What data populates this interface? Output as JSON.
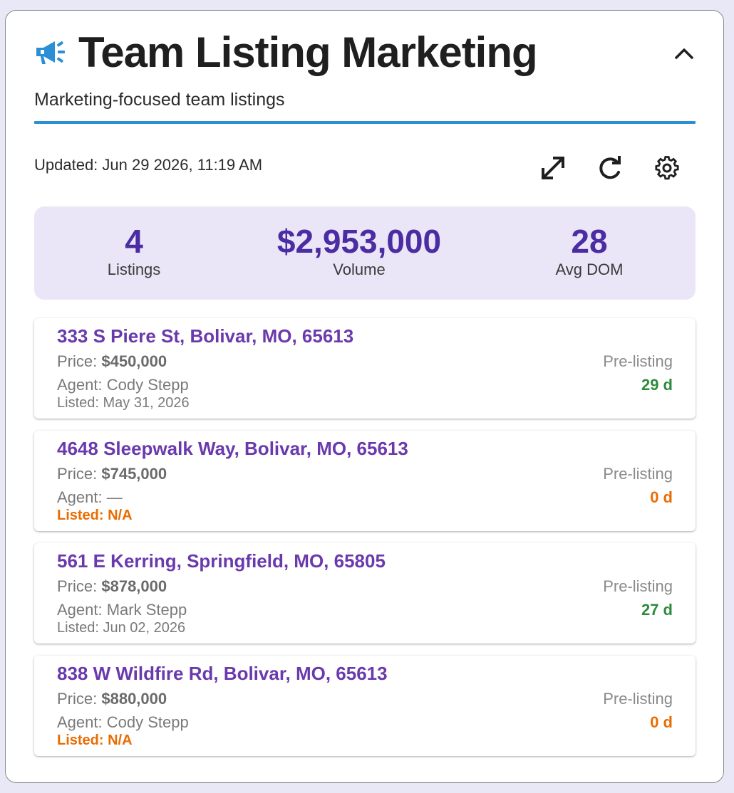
{
  "header": {
    "title": "Team Listing Marketing",
    "subtitle": "Marketing-focused team listings",
    "icon": "megaphone-icon",
    "accent_color": "#2b8fd6"
  },
  "toolbar": {
    "updated_text": "Updated: Jun 29 2026, 11:19 AM",
    "icons": [
      "expand-icon",
      "refresh-icon",
      "settings-gear-icon"
    ]
  },
  "summary": {
    "listings": {
      "value": "4",
      "label": "Listings"
    },
    "volume": {
      "value": "$2,953,000",
      "label": "Volume"
    },
    "avg_dom": {
      "value": "28",
      "label": "Avg DOM"
    },
    "value_color": "#4b2ca3",
    "background": "#ebe6f7"
  },
  "listings": [
    {
      "address": "333 S Piere St, Bolivar, MO, 65613",
      "price_label": "Price: ",
      "price": "$450,000",
      "agent": "Agent: Cody Stepp",
      "listed": "Listed: May 31, 2026",
      "listed_na": false,
      "status": "Pre-listing",
      "dom": "29 d",
      "dom_color": "green"
    },
    {
      "address": "4648 Sleepwalk Way, Bolivar, MO, 65613",
      "price_label": "Price: ",
      "price": "$745,000",
      "agent": "Agent: —",
      "listed": "Listed: N/A",
      "listed_na": true,
      "status": "Pre-listing",
      "dom": "0 d",
      "dom_color": "orange"
    },
    {
      "address": "561 E Kerring, Springfield, MO, 65805",
      "price_label": "Price: ",
      "price": "$878,000",
      "agent": "Agent: Mark Stepp",
      "listed": "Listed: Jun 02, 2026",
      "listed_na": false,
      "status": "Pre-listing",
      "dom": "27 d",
      "dom_color": "green"
    },
    {
      "address": "838 W Wildfire Rd, Bolivar, MO, 65613",
      "price_label": "Price: ",
      "price": "$880,000",
      "agent": "Agent: Cody Stepp",
      "listed": "Listed: N/A",
      "listed_na": true,
      "status": "Pre-listing",
      "dom": "0 d",
      "dom_color": "orange"
    }
  ]
}
